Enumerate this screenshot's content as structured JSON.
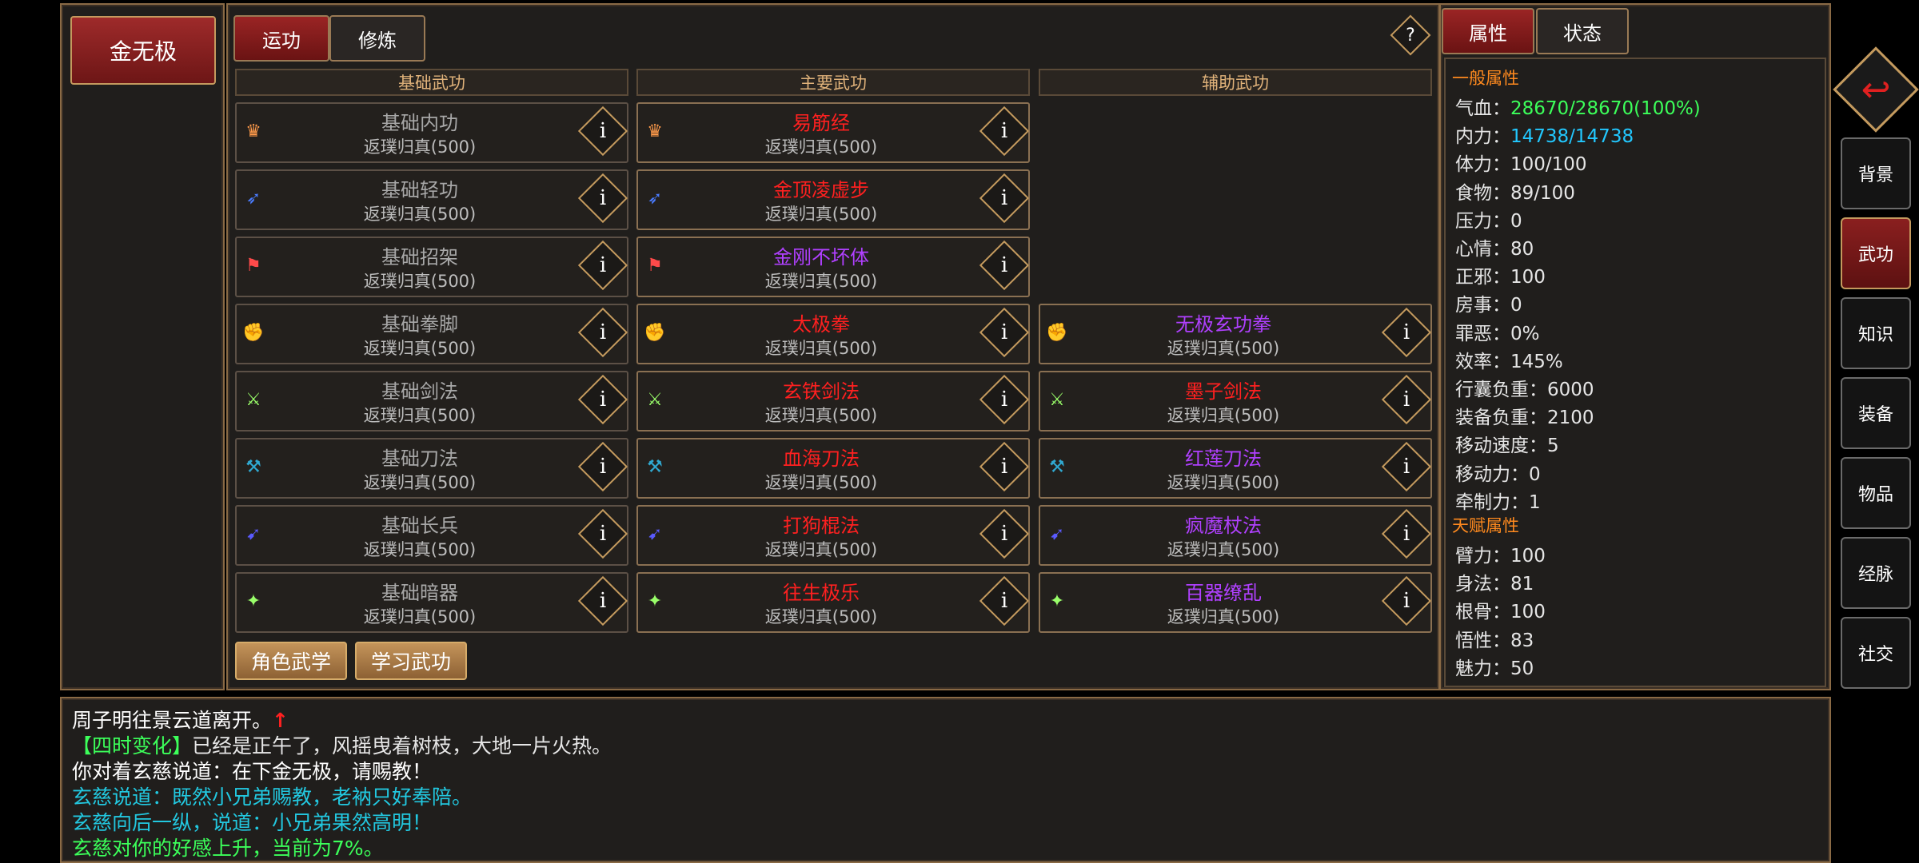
{
  "character": {
    "name": "金无极"
  },
  "tabs": {
    "active": "运功",
    "other": "修炼"
  },
  "help_icon": "?",
  "columns": {
    "basic": "基础武功",
    "main": "主要武功",
    "aux": "辅助武功"
  },
  "basic_skills": [
    {
      "name": "基础内功",
      "level": "返璞归真(500)",
      "icon": "♛"
    },
    {
      "name": "基础轻功",
      "level": "返璞归真(500)",
      "icon": "➶"
    },
    {
      "name": "基础招架",
      "level": "返璞归真(500)",
      "icon": "⚑"
    },
    {
      "name": "基础拳脚",
      "level": "返璞归真(500)",
      "icon": "✊"
    },
    {
      "name": "基础剑法",
      "level": "返璞归真(500)",
      "icon": "⚔"
    },
    {
      "name": "基础刀法",
      "level": "返璞归真(500)",
      "icon": "⚒"
    },
    {
      "name": "基础长兵",
      "level": "返璞归真(500)",
      "icon": "➹"
    },
    {
      "name": "基础暗器",
      "level": "返璞归真(500)",
      "icon": "✦"
    }
  ],
  "main_skills": [
    {
      "name": "易筋经",
      "level": "返璞归真(500)",
      "color": "red",
      "icon": "♛"
    },
    {
      "name": "金顶凌虚步",
      "level": "返璞归真(500)",
      "color": "red",
      "icon": "➶"
    },
    {
      "name": "金刚不坏体",
      "level": "返璞归真(500)",
      "color": "purple",
      "icon": "⚑"
    },
    {
      "name": "太极拳",
      "level": "返璞归真(500)",
      "color": "red",
      "icon": "✊"
    },
    {
      "name": "玄铁剑法",
      "level": "返璞归真(500)",
      "color": "red",
      "icon": "⚔"
    },
    {
      "name": "血海刀法",
      "level": "返璞归真(500)",
      "color": "red",
      "icon": "⚒"
    },
    {
      "name": "打狗棍法",
      "level": "返璞归真(500)",
      "color": "red",
      "icon": "➹"
    },
    {
      "name": "往生极乐",
      "level": "返璞归真(500)",
      "color": "red",
      "icon": "✦"
    }
  ],
  "aux_skills": [
    {
      "name": "无极玄功拳",
      "level": "返璞归真(500)",
      "color": "purple",
      "icon": "✊"
    },
    {
      "name": "墨子剑法",
      "level": "返璞归真(500)",
      "color": "red",
      "icon": "⚔"
    },
    {
      "name": "红莲刀法",
      "level": "返璞归真(500)",
      "color": "purple",
      "icon": "⚒"
    },
    {
      "name": "疯魔杖法",
      "level": "返璞归真(500)",
      "color": "purple",
      "icon": "➹"
    },
    {
      "name": "百器缭乱",
      "level": "返璞归真(500)",
      "color": "purple",
      "icon": "✦"
    }
  ],
  "actions": {
    "role_skills": "角色武学",
    "learn_skills": "学习武功"
  },
  "right_tabs": {
    "attributes": "属性",
    "status": "状态"
  },
  "general_attrs_header": "一般属性",
  "general_attrs": [
    {
      "label": "气血：",
      "value": "28670/28670(100%)",
      "color": "#3cff5a"
    },
    {
      "label": "内力：",
      "value": "14738/14738",
      "color": "#22c8ff"
    },
    {
      "label": "体力：",
      "value": "100/100",
      "color": "#e6e6e6"
    },
    {
      "label": "食物：",
      "value": "89/100",
      "color": "#e6e6e6"
    },
    {
      "label": "压力：",
      "value": "0",
      "color": "#e6e6e6"
    },
    {
      "label": "心情：",
      "value": "80",
      "color": "#e6e6e6"
    },
    {
      "label": "正邪：",
      "value": "100",
      "color": "#e6e6e6"
    },
    {
      "label": "房事：",
      "value": "0",
      "color": "#e6e6e6"
    },
    {
      "label": "罪恶：",
      "value": "0%",
      "color": "#e6e6e6"
    },
    {
      "label": "效率：",
      "value": "145%",
      "color": "#e6e6e6"
    },
    {
      "label": "行囊负重：",
      "value": "6000",
      "color": "#e6e6e6"
    },
    {
      "label": "装备负重：",
      "value": "2100",
      "color": "#e6e6e6"
    },
    {
      "label": "移动速度：",
      "value": "5",
      "color": "#e6e6e6"
    },
    {
      "label": "移动力：",
      "value": "0",
      "color": "#e6e6e6"
    },
    {
      "label": "牵制力：",
      "value": "1",
      "color": "#e6e6e6"
    }
  ],
  "talent_attrs_header": "天赋属性",
  "talent_attrs": [
    {
      "label": "臂力：",
      "value": "100"
    },
    {
      "label": "身法：",
      "value": "81"
    },
    {
      "label": "根骨：",
      "value": "100"
    },
    {
      "label": "悟性：",
      "value": "83"
    },
    {
      "label": "魅力：",
      "value": "50"
    }
  ],
  "side_menu": [
    "背景",
    "武功",
    "知识",
    "装备",
    "物品",
    "经脉",
    "社交"
  ],
  "side_menu_active": "武功",
  "log": [
    {
      "text": "周子明往景云道离开。",
      "color": "#ffffff",
      "arrow": "↑"
    },
    {
      "prefix": "【四时变化】",
      "text": "已经是正午了，风摇曳着树枝，大地一片火热。",
      "color": "#e6e6e6",
      "prefix_color": "#3cff5a"
    },
    {
      "text": "你对着玄慈说道：在下金无极，请赐教！",
      "color": "#ffffff"
    },
    {
      "text": "玄慈说道：既然小兄弟赐教，老衲只好奉陪。",
      "color": "#22c8e0"
    },
    {
      "text": "玄慈向后一纵，说道：小兄弟果然高明！",
      "color": "#22c8e0"
    },
    {
      "text": "玄慈对你的好感上升，当前为7%。",
      "color": "#3cff5a"
    }
  ]
}
